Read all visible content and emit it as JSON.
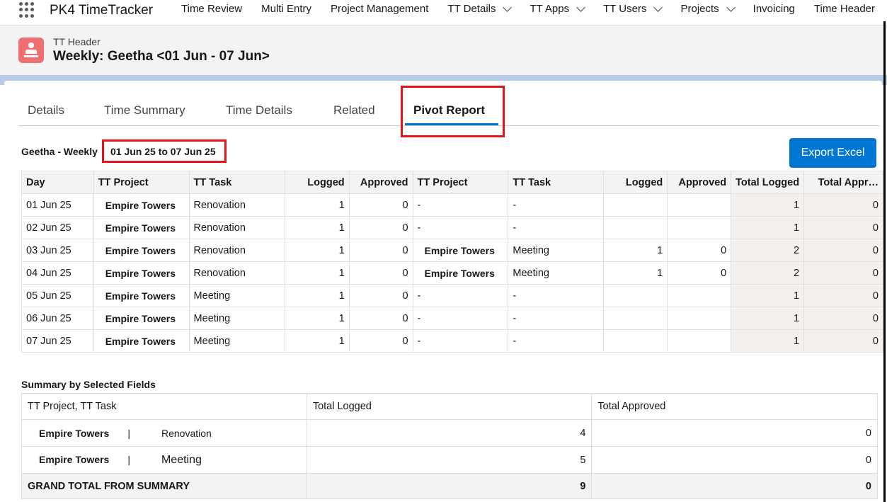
{
  "app": {
    "name": "PK4 TimeTracker"
  },
  "nav": [
    {
      "label": "Time Review",
      "chevron": false
    },
    {
      "label": "Multi Entry",
      "chevron": false
    },
    {
      "label": "Project Management",
      "chevron": false
    },
    {
      "label": "TT Details",
      "chevron": true
    },
    {
      "label": "TT Apps",
      "chevron": true
    },
    {
      "label": "TT Users",
      "chevron": true
    },
    {
      "label": "Projects",
      "chevron": true
    },
    {
      "label": "Invoicing",
      "chevron": false
    },
    {
      "label": "Time Header",
      "chevron": false
    }
  ],
  "header": {
    "object_label": "TT Header",
    "title": "Weekly: Geetha <01 Jun - 07 Jun>"
  },
  "tabs": [
    {
      "label": "Details"
    },
    {
      "label": "Time Summary"
    },
    {
      "label": "Time Details"
    },
    {
      "label": "Related"
    },
    {
      "label": "Pivot Report",
      "active": true
    }
  ],
  "report": {
    "owner_label": "Geetha - Weekly",
    "date_range": "01 Jun 25 to 07 Jun 25",
    "export_label": "Export Excel"
  },
  "pivot": {
    "headers": [
      "Day",
      "TT Project",
      "TT Task",
      "Logged",
      "Approved",
      "TT Project",
      "TT Task",
      "Logged",
      "Approved",
      "Total Logged",
      "Total Appr…"
    ],
    "rows": [
      [
        "01 Jun 25",
        "Empire Towers",
        "Renovation",
        "1",
        "0",
        "-",
        "-",
        "",
        "",
        "1",
        "0"
      ],
      [
        "02 Jun 25",
        "Empire Towers",
        "Renovation",
        "1",
        "0",
        "-",
        "-",
        "",
        "",
        "1",
        "0"
      ],
      [
        "03 Jun 25",
        "Empire Towers",
        "Renovation",
        "1",
        "0",
        "Empire Towers",
        "Meeting",
        "1",
        "0",
        "2",
        "0"
      ],
      [
        "04 Jun 25",
        "Empire Towers",
        "Renovation",
        "1",
        "0",
        "Empire Towers",
        "Meeting",
        "1",
        "0",
        "2",
        "0"
      ],
      [
        "05 Jun 25",
        "Empire Towers",
        "Meeting",
        "1",
        "0",
        "-",
        "-",
        "",
        "",
        "1",
        "0"
      ],
      [
        "06 Jun 25",
        "Empire Towers",
        "Meeting",
        "1",
        "0",
        "-",
        "-",
        "",
        "",
        "1",
        "0"
      ],
      [
        "07 Jun 25",
        "Empire Towers",
        "Meeting",
        "1",
        "0",
        "-",
        "-",
        "",
        "",
        "1",
        "0"
      ]
    ]
  },
  "summary": {
    "title": "Summary by Selected Fields",
    "headers": [
      "TT Project, TT Task",
      "Total Logged",
      "Total Approved"
    ],
    "rows": [
      {
        "project": "Empire Towers",
        "separator": "|",
        "task": "Renovation",
        "logged": "4",
        "approved": "0"
      },
      {
        "project": "Empire Towers",
        "separator": "|",
        "task": "Meeting",
        "logged": "5",
        "approved": "0"
      }
    ],
    "grand_total": {
      "label": "GRAND TOTAL FROM SUMMARY",
      "logged": "9",
      "approved": "0"
    }
  },
  "colors": {
    "brand_blue": "#0176d3",
    "highlight_red": "#e4141c",
    "header_icon": "#f06f72"
  },
  "icons": {
    "app_launcher": "waffle-icon",
    "header_object": "timesheet-icon"
  }
}
